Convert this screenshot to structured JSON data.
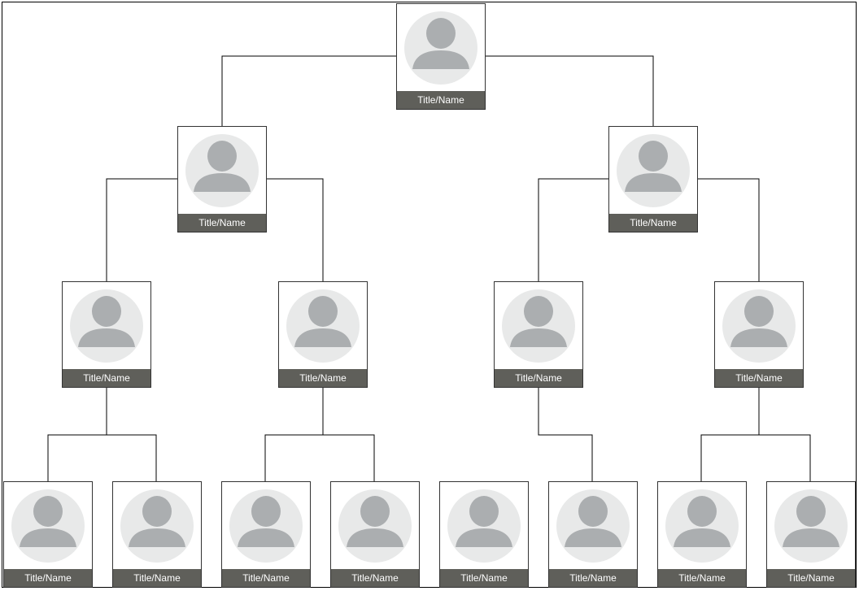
{
  "colors": {
    "bar": "#5f5f5a",
    "circle": "#e8e9e9",
    "figure": "#abaeb0",
    "line": "#000000"
  },
  "icon": "person-avatar-icon",
  "nodes": [
    {
      "id": "root",
      "label": "Title/Name"
    },
    {
      "id": "l2a",
      "label": "Title/Name"
    },
    {
      "id": "l2b",
      "label": "Title/Name"
    },
    {
      "id": "l3a",
      "label": "Title/Name"
    },
    {
      "id": "l3b",
      "label": "Title/Name"
    },
    {
      "id": "l3c",
      "label": "Title/Name"
    },
    {
      "id": "l3d",
      "label": "Title/Name"
    },
    {
      "id": "l4a",
      "label": "Title/Name"
    },
    {
      "id": "l4b",
      "label": "Title/Name"
    },
    {
      "id": "l4c",
      "label": "Title/Name"
    },
    {
      "id": "l4d",
      "label": "Title/Name"
    },
    {
      "id": "l4e",
      "label": "Title/Name"
    },
    {
      "id": "l4f",
      "label": "Title/Name"
    },
    {
      "id": "l4g",
      "label": "Title/Name"
    },
    {
      "id": "l4h",
      "label": "Title/Name"
    }
  ],
  "edges": [
    [
      "root",
      "l2a"
    ],
    [
      "root",
      "l2b"
    ],
    [
      "l2a",
      "l3a"
    ],
    [
      "l2a",
      "l3b"
    ],
    [
      "l2b",
      "l3c"
    ],
    [
      "l2b",
      "l3d"
    ],
    [
      "l3a",
      "l4a"
    ],
    [
      "l3a",
      "l4b"
    ],
    [
      "l3b",
      "l4c"
    ],
    [
      "l3b",
      "l4d"
    ],
    [
      "l3c",
      "l4f"
    ],
    [
      "l3d",
      "l4g"
    ],
    [
      "l3d",
      "l4h"
    ]
  ]
}
